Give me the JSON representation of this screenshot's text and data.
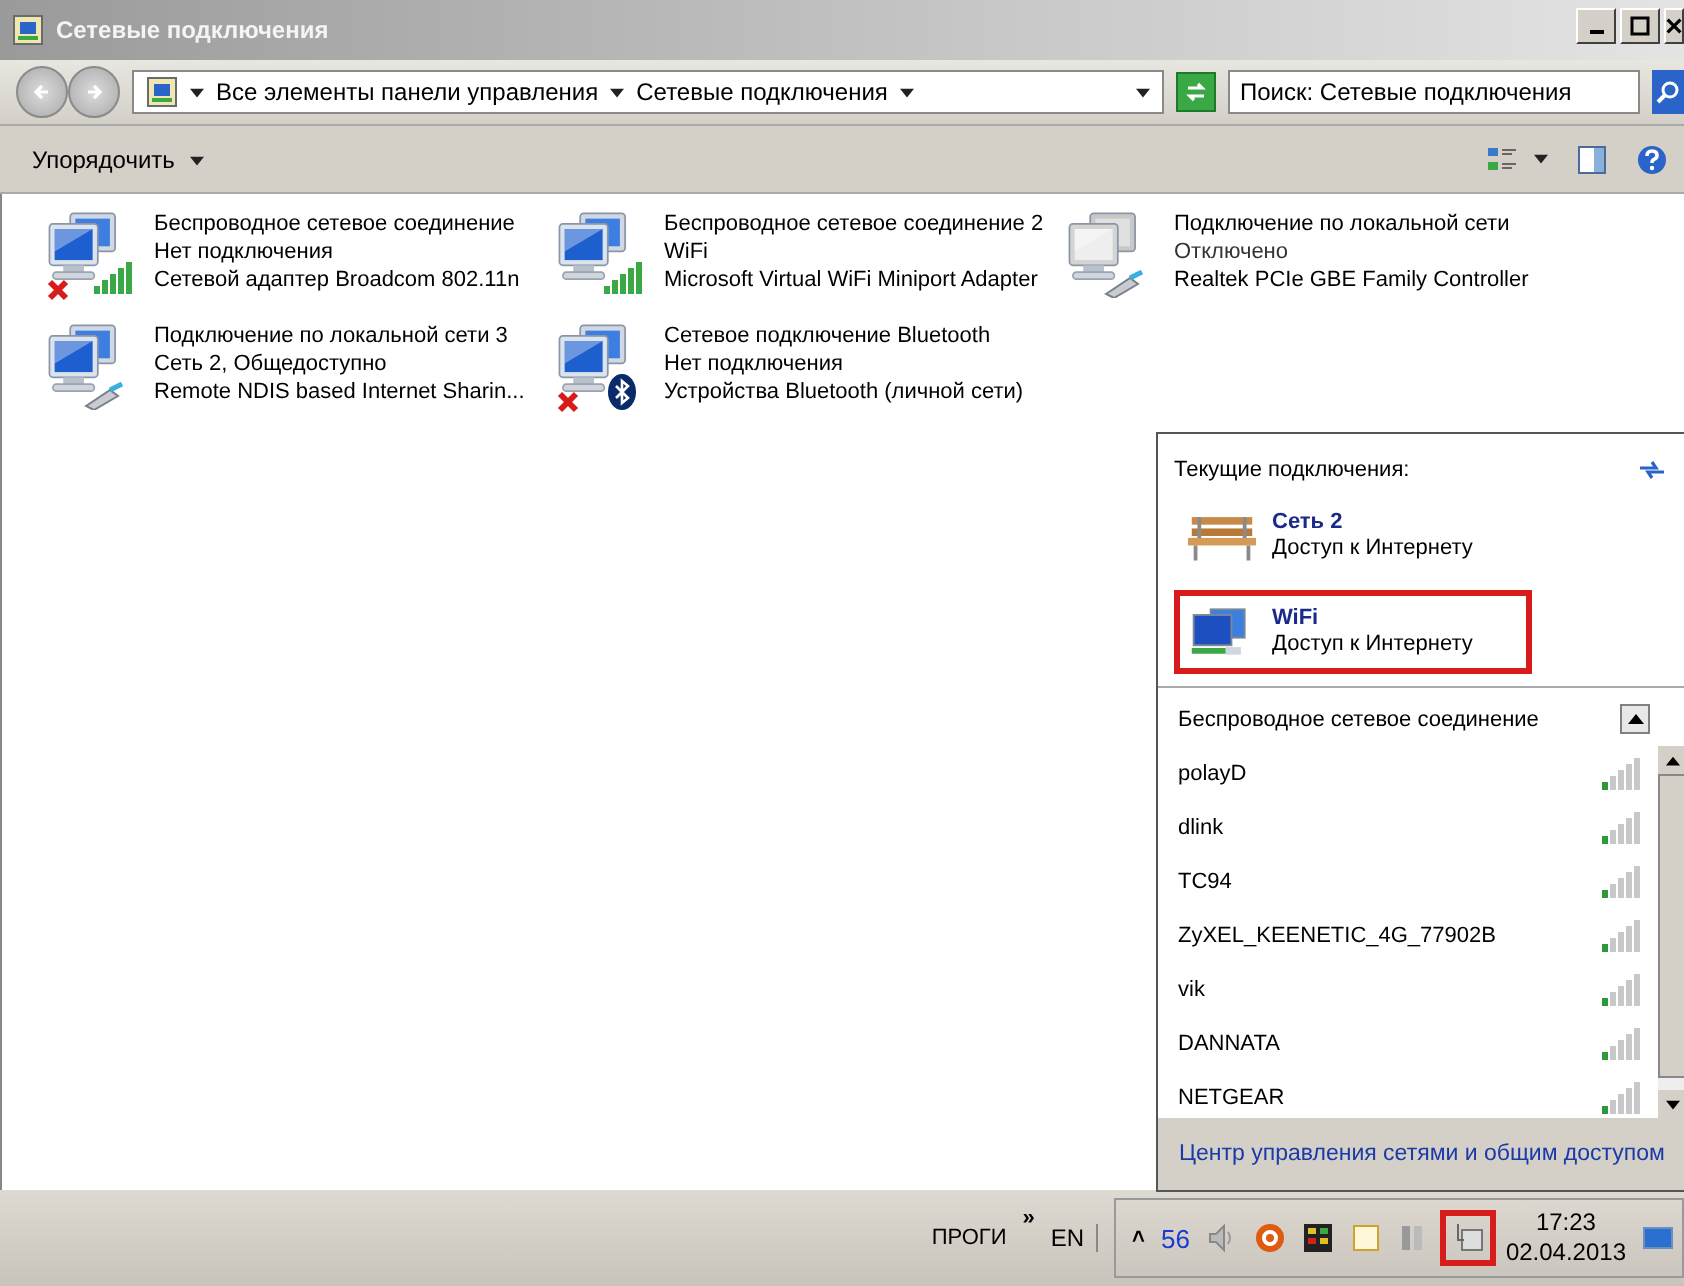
{
  "window": {
    "title": "Сетевые подключения"
  },
  "address_bar": {
    "crumbs": [
      "Все элементы панели управления",
      "Сетевые подключения"
    ]
  },
  "search": {
    "placeholder": "Поиск: Сетевые подключения"
  },
  "toolbar": {
    "organize": "Упорядочить"
  },
  "connections": [
    {
      "name": "Беспроводное сетевое соединение",
      "status": "Нет подключения",
      "adapter": "Сетевой адаптер Broadcom 802.11n",
      "kind": "wireless",
      "disconnected": true,
      "disabled": false
    },
    {
      "name": "Беспроводное сетевое соединение 2",
      "status": "WiFi",
      "adapter": "Microsoft Virtual WiFi Miniport Adapter",
      "kind": "wireless",
      "disconnected": false,
      "disabled": false
    },
    {
      "name": "Подключение по локальной сети",
      "status": "Отключено",
      "adapter": "Realtek PCIe GBE Family Controller",
      "kind": "cable",
      "disconnected": false,
      "disabled": true
    },
    {
      "name": "Подключение по локальной сети 3",
      "status": "Сеть  2, Общедоступно",
      "adapter": "Remote NDIS based Internet Sharin...",
      "kind": "cable",
      "disconnected": false,
      "disabled": false
    },
    {
      "name": "Сетевое подключение Bluetooth",
      "status": "Нет подключения",
      "adapter": "Устройства Bluetooth (личной сети)",
      "kind": "bluetooth",
      "disconnected": true,
      "disabled": false
    }
  ],
  "flyout": {
    "heading": "Текущие подключения:",
    "current": [
      {
        "name": "Сеть  2",
        "access": "Доступ к Интернету",
        "kind": "bench",
        "highlighted": false
      },
      {
        "name": "WiFi",
        "access": "Доступ к Интернету",
        "kind": "computer",
        "highlighted": true
      }
    ],
    "section": "Беспроводное сетевое соединение",
    "networks": [
      "polayD",
      "dlink",
      "TC94",
      "ZyXEL_KEENETIC_4G_77902B",
      "vik",
      "DANNATA",
      "NETGEAR"
    ],
    "footer_link": "Центр управления сетями и общим доступом"
  },
  "taskbar": {
    "toolbar_label": "ПРОГИ",
    "chevron": "»",
    "language": "EN",
    "tray_expand": "˄",
    "tray_number": "56",
    "network_icon_highlighted": true,
    "time": "17:23",
    "date": "02.04.2013"
  }
}
